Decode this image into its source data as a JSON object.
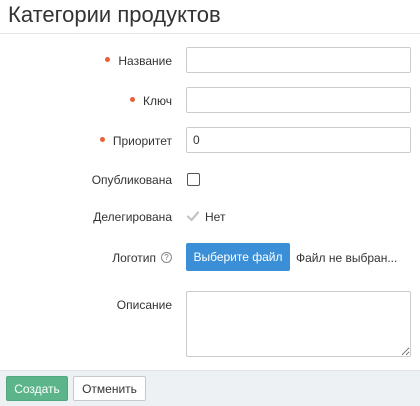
{
  "page": {
    "title": "Категории продуктов"
  },
  "form": {
    "name": {
      "label": "Название",
      "required": true,
      "value": ""
    },
    "key": {
      "label": "Ключ",
      "required": true,
      "value": ""
    },
    "priority": {
      "label": "Приоритет",
      "required": true,
      "value": "0"
    },
    "published": {
      "label": "Опубликована",
      "checked": false
    },
    "delegated": {
      "label": "Делегирована",
      "value": "Нет"
    },
    "logo": {
      "label": "Логотип",
      "choose_button": "Выберите файл",
      "status": "Файл не выбран..."
    },
    "description": {
      "label": "Описание",
      "value": ""
    }
  },
  "footer": {
    "create_label": "Создать",
    "cancel_label": "Отменить"
  },
  "colors": {
    "required_dot": "#e8603c",
    "primary": "#3a8fd6",
    "success": "#5cb58a"
  }
}
